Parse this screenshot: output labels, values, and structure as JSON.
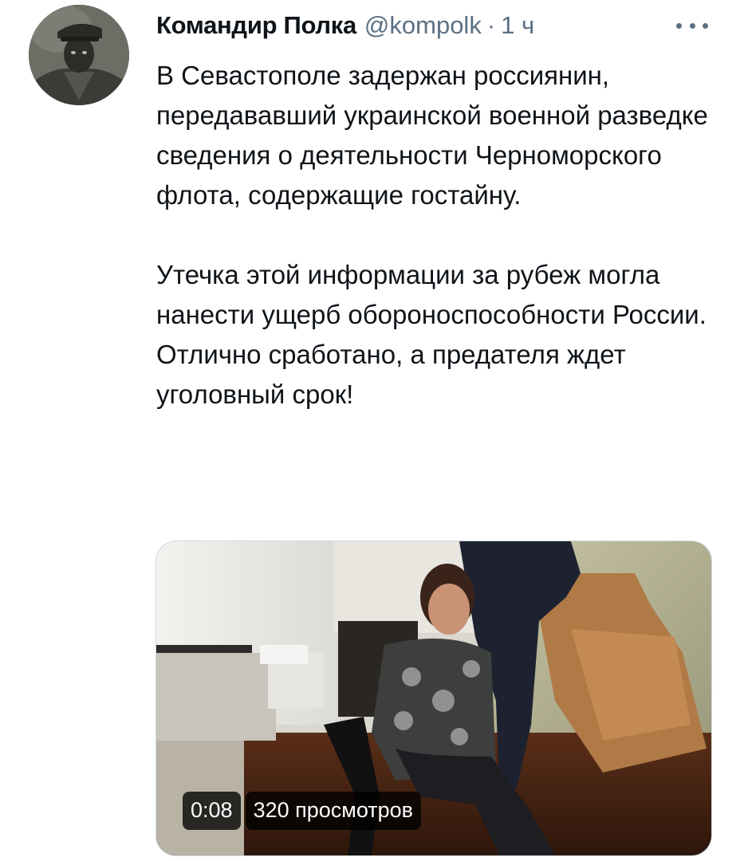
{
  "tweet": {
    "author_name": "Командир Полка",
    "handle": "@kompolk",
    "separator": "·",
    "time": "1 ч",
    "more_icon": "ellipsis-icon",
    "paragraph_1": "В Севастополе задержан россиянин, передававший украинской военной разведке сведения о деятельности Черноморского флота, содержащие гостайну.",
    "paragraph_2": "Утечка этой информации за рубеж могла нанести ущерб обороноспособности России. Отлично сработано, а предателя ждет уголовный срок!"
  },
  "video": {
    "duration": "0:08",
    "views": "320 просмотров"
  },
  "colors": {
    "text_primary": "#0f1419",
    "text_secondary": "#5b7083",
    "media_border": "#cfd9de",
    "badge_bg": "#000000"
  }
}
